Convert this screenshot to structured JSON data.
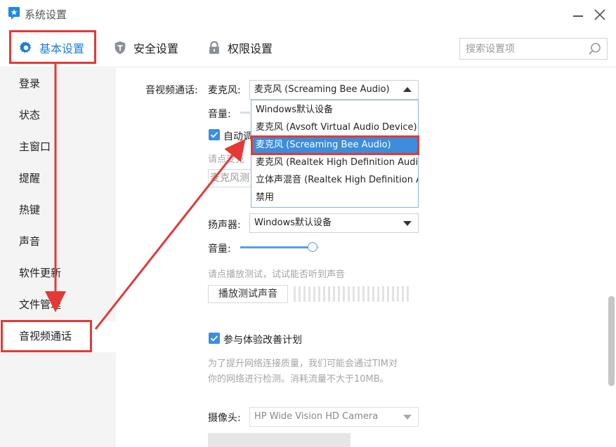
{
  "window": {
    "title": "系统设置"
  },
  "tabs": [
    {
      "label": "基本设置",
      "icon": "gear-icon",
      "active": true
    },
    {
      "label": "安全设置",
      "icon": "shield-icon",
      "active": false
    },
    {
      "label": "权限设置",
      "icon": "lock-icon",
      "active": false
    }
  ],
  "search": {
    "placeholder": "搜索设置项"
  },
  "sidebar": {
    "items": [
      {
        "label": "登录"
      },
      {
        "label": "状态"
      },
      {
        "label": "主窗口"
      },
      {
        "label": "提醒"
      },
      {
        "label": "热键"
      },
      {
        "label": "声音"
      },
      {
        "label": "软件更新"
      },
      {
        "label": "文件管理"
      },
      {
        "label": "音视频通话",
        "active": true
      }
    ]
  },
  "av": {
    "section_label": "音视频通话:",
    "mic_label": "麦克风:",
    "mic_selected": "麦克风 (Screaming Bee Audio)",
    "mic_options": [
      "Windows默认设备",
      "麦克风 (Avsoft Virtual Audio Device)",
      "麦克风 (Screaming Bee Audio)",
      "麦克风 (Realtek High Definition Audio(",
      "立体声混音 (Realtek High Definition A",
      "禁用"
    ],
    "mic_selected_index": 2,
    "mic_volume_label": "音量:",
    "auto_adjust_label": "自动调",
    "mic_test_hint": "请点麦克",
    "mic_test_button": "麦克风测",
    "speaker_label": "扬声器:",
    "speaker_selected": "Windows默认设备",
    "speaker_volume_label": "音量:",
    "speaker_volume_level": 0.92,
    "playback_hint": "请点播放测试，试试能否听到声音",
    "playback_button": "播放测试声音",
    "improve_label": "参与体验改善计划",
    "improve_desc_line1": "为了提升网络连接质量，我们可能会通过TIM对",
    "improve_desc_line2": "你的网络进行检测。消耗流量不大于10MB。",
    "camera_label": "摄像头:",
    "camera_selected": "HP Wide Vision HD Camera"
  },
  "colors": {
    "accent": "#1a7fd6",
    "annotation": "#e53935",
    "selection": "#3c8ddb"
  }
}
